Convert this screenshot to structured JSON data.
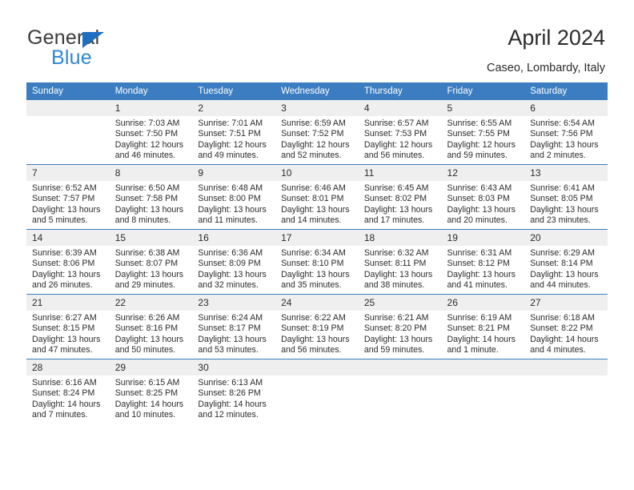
{
  "brand": {
    "name_part1": "General",
    "name_part2": "Blue",
    "accent_color": "#2f86d6",
    "triangle_color": "#1f6fc0"
  },
  "header": {
    "title": "April 2024",
    "subtitle": "Caseo, Lombardy, Italy"
  },
  "calendar": {
    "header_bg": "#3b7dc0",
    "daynum_bg": "#efefef",
    "weekday_headers": [
      "Sunday",
      "Monday",
      "Tuesday",
      "Wednesday",
      "Thursday",
      "Friday",
      "Saturday"
    ],
    "weeks": [
      [
        {
          "day": "",
          "sunrise": "",
          "sunset": "",
          "daylight1": "",
          "daylight2": ""
        },
        {
          "day": "1",
          "sunrise": "Sunrise: 7:03 AM",
          "sunset": "Sunset: 7:50 PM",
          "daylight1": "Daylight: 12 hours",
          "daylight2": "and 46 minutes."
        },
        {
          "day": "2",
          "sunrise": "Sunrise: 7:01 AM",
          "sunset": "Sunset: 7:51 PM",
          "daylight1": "Daylight: 12 hours",
          "daylight2": "and 49 minutes."
        },
        {
          "day": "3",
          "sunrise": "Sunrise: 6:59 AM",
          "sunset": "Sunset: 7:52 PM",
          "daylight1": "Daylight: 12 hours",
          "daylight2": "and 52 minutes."
        },
        {
          "day": "4",
          "sunrise": "Sunrise: 6:57 AM",
          "sunset": "Sunset: 7:53 PM",
          "daylight1": "Daylight: 12 hours",
          "daylight2": "and 56 minutes."
        },
        {
          "day": "5",
          "sunrise": "Sunrise: 6:55 AM",
          "sunset": "Sunset: 7:55 PM",
          "daylight1": "Daylight: 12 hours",
          "daylight2": "and 59 minutes."
        },
        {
          "day": "6",
          "sunrise": "Sunrise: 6:54 AM",
          "sunset": "Sunset: 7:56 PM",
          "daylight1": "Daylight: 13 hours",
          "daylight2": "and 2 minutes."
        }
      ],
      [
        {
          "day": "7",
          "sunrise": "Sunrise: 6:52 AM",
          "sunset": "Sunset: 7:57 PM",
          "daylight1": "Daylight: 13 hours",
          "daylight2": "and 5 minutes."
        },
        {
          "day": "8",
          "sunrise": "Sunrise: 6:50 AM",
          "sunset": "Sunset: 7:58 PM",
          "daylight1": "Daylight: 13 hours",
          "daylight2": "and 8 minutes."
        },
        {
          "day": "9",
          "sunrise": "Sunrise: 6:48 AM",
          "sunset": "Sunset: 8:00 PM",
          "daylight1": "Daylight: 13 hours",
          "daylight2": "and 11 minutes."
        },
        {
          "day": "10",
          "sunrise": "Sunrise: 6:46 AM",
          "sunset": "Sunset: 8:01 PM",
          "daylight1": "Daylight: 13 hours",
          "daylight2": "and 14 minutes."
        },
        {
          "day": "11",
          "sunrise": "Sunrise: 6:45 AM",
          "sunset": "Sunset: 8:02 PM",
          "daylight1": "Daylight: 13 hours",
          "daylight2": "and 17 minutes."
        },
        {
          "day": "12",
          "sunrise": "Sunrise: 6:43 AM",
          "sunset": "Sunset: 8:03 PM",
          "daylight1": "Daylight: 13 hours",
          "daylight2": "and 20 minutes."
        },
        {
          "day": "13",
          "sunrise": "Sunrise: 6:41 AM",
          "sunset": "Sunset: 8:05 PM",
          "daylight1": "Daylight: 13 hours",
          "daylight2": "and 23 minutes."
        }
      ],
      [
        {
          "day": "14",
          "sunrise": "Sunrise: 6:39 AM",
          "sunset": "Sunset: 8:06 PM",
          "daylight1": "Daylight: 13 hours",
          "daylight2": "and 26 minutes."
        },
        {
          "day": "15",
          "sunrise": "Sunrise: 6:38 AM",
          "sunset": "Sunset: 8:07 PM",
          "daylight1": "Daylight: 13 hours",
          "daylight2": "and 29 minutes."
        },
        {
          "day": "16",
          "sunrise": "Sunrise: 6:36 AM",
          "sunset": "Sunset: 8:09 PM",
          "daylight1": "Daylight: 13 hours",
          "daylight2": "and 32 minutes."
        },
        {
          "day": "17",
          "sunrise": "Sunrise: 6:34 AM",
          "sunset": "Sunset: 8:10 PM",
          "daylight1": "Daylight: 13 hours",
          "daylight2": "and 35 minutes."
        },
        {
          "day": "18",
          "sunrise": "Sunrise: 6:32 AM",
          "sunset": "Sunset: 8:11 PM",
          "daylight1": "Daylight: 13 hours",
          "daylight2": "and 38 minutes."
        },
        {
          "day": "19",
          "sunrise": "Sunrise: 6:31 AM",
          "sunset": "Sunset: 8:12 PM",
          "daylight1": "Daylight: 13 hours",
          "daylight2": "and 41 minutes."
        },
        {
          "day": "20",
          "sunrise": "Sunrise: 6:29 AM",
          "sunset": "Sunset: 8:14 PM",
          "daylight1": "Daylight: 13 hours",
          "daylight2": "and 44 minutes."
        }
      ],
      [
        {
          "day": "21",
          "sunrise": "Sunrise: 6:27 AM",
          "sunset": "Sunset: 8:15 PM",
          "daylight1": "Daylight: 13 hours",
          "daylight2": "and 47 minutes."
        },
        {
          "day": "22",
          "sunrise": "Sunrise: 6:26 AM",
          "sunset": "Sunset: 8:16 PM",
          "daylight1": "Daylight: 13 hours",
          "daylight2": "and 50 minutes."
        },
        {
          "day": "23",
          "sunrise": "Sunrise: 6:24 AM",
          "sunset": "Sunset: 8:17 PM",
          "daylight1": "Daylight: 13 hours",
          "daylight2": "and 53 minutes."
        },
        {
          "day": "24",
          "sunrise": "Sunrise: 6:22 AM",
          "sunset": "Sunset: 8:19 PM",
          "daylight1": "Daylight: 13 hours",
          "daylight2": "and 56 minutes."
        },
        {
          "day": "25",
          "sunrise": "Sunrise: 6:21 AM",
          "sunset": "Sunset: 8:20 PM",
          "daylight1": "Daylight: 13 hours",
          "daylight2": "and 59 minutes."
        },
        {
          "day": "26",
          "sunrise": "Sunrise: 6:19 AM",
          "sunset": "Sunset: 8:21 PM",
          "daylight1": "Daylight: 14 hours",
          "daylight2": "and 1 minute."
        },
        {
          "day": "27",
          "sunrise": "Sunrise: 6:18 AM",
          "sunset": "Sunset: 8:22 PM",
          "daylight1": "Daylight: 14 hours",
          "daylight2": "and 4 minutes."
        }
      ],
      [
        {
          "day": "28",
          "sunrise": "Sunrise: 6:16 AM",
          "sunset": "Sunset: 8:24 PM",
          "daylight1": "Daylight: 14 hours",
          "daylight2": "and 7 minutes."
        },
        {
          "day": "29",
          "sunrise": "Sunrise: 6:15 AM",
          "sunset": "Sunset: 8:25 PM",
          "daylight1": "Daylight: 14 hours",
          "daylight2": "and 10 minutes."
        },
        {
          "day": "30",
          "sunrise": "Sunrise: 6:13 AM",
          "sunset": "Sunset: 8:26 PM",
          "daylight1": "Daylight: 14 hours",
          "daylight2": "and 12 minutes."
        },
        {
          "day": "",
          "sunrise": "",
          "sunset": "",
          "daylight1": "",
          "daylight2": ""
        },
        {
          "day": "",
          "sunrise": "",
          "sunset": "",
          "daylight1": "",
          "daylight2": ""
        },
        {
          "day": "",
          "sunrise": "",
          "sunset": "",
          "daylight1": "",
          "daylight2": ""
        },
        {
          "day": "",
          "sunrise": "",
          "sunset": "",
          "daylight1": "",
          "daylight2": ""
        }
      ]
    ]
  }
}
